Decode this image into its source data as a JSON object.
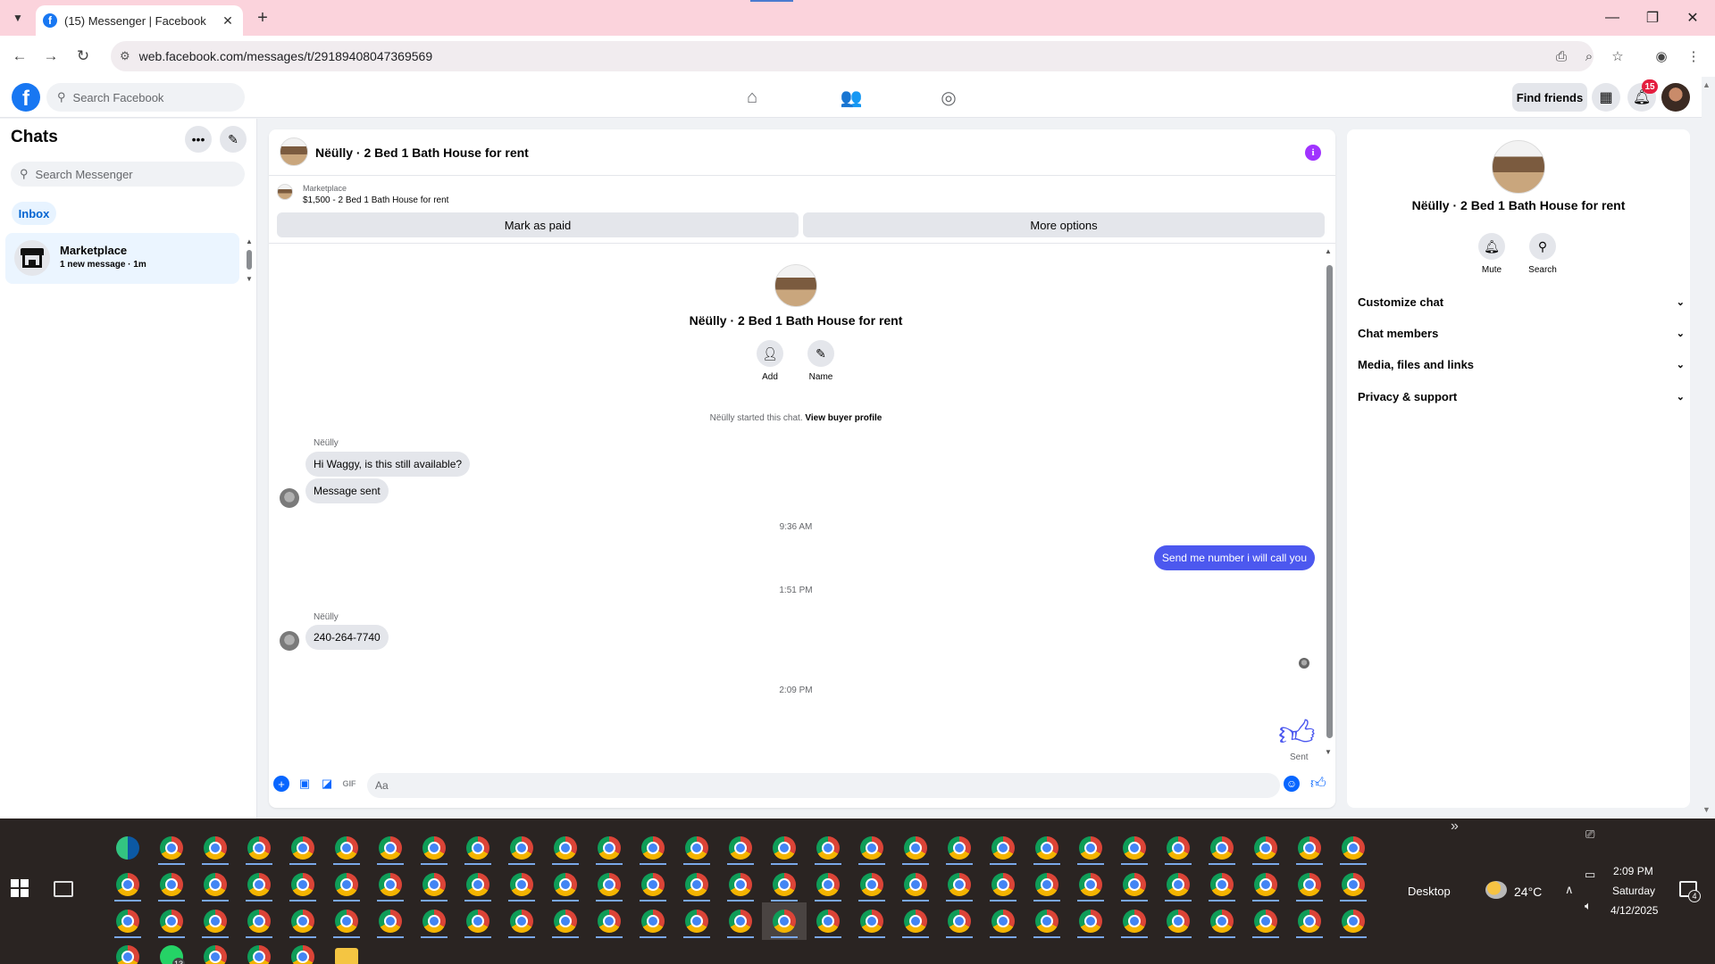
{
  "browser": {
    "tab_title": "(15) Messenger | Facebook",
    "url": "web.facebook.com/messages/t/29189408047369569",
    "new_tab_symbol": "+",
    "close_tab_symbol": "✕"
  },
  "fb": {
    "logo_letter": "f",
    "search_placeholder": "Search Facebook",
    "find_friends_label": "Find friends",
    "notification_count": "15"
  },
  "sidebar": {
    "title": "Chats",
    "search_placeholder": "Search Messenger",
    "inbox_label": "Inbox",
    "chats": [
      {
        "name": "Marketplace",
        "preview": "1 new message · 1m"
      }
    ]
  },
  "conversation": {
    "title": "Nëülly · 2 Bed 1 Bath House for rent",
    "marketplace_label": "Marketplace",
    "listing_line": "$1,500 - 2 Bed 1 Bath House for rent",
    "mark_paid_label": "Mark as paid",
    "more_options_label": "More options",
    "intro_name": "Nëülly · 2 Bed 1 Bath House for rent",
    "add_label": "Add",
    "name_label": "Name",
    "started_text": "Nëülly started this chat.",
    "view_profile_link": "View buyer profile",
    "messages": [
      {
        "sender": "Nëülly",
        "text": "Hi Waggy, is this still available?"
      },
      {
        "text": "Message sent"
      },
      {
        "timestamp": "9:36 AM"
      },
      {
        "mine": true,
        "text": "Send me number i will call you"
      },
      {
        "timestamp": "1:51 PM"
      },
      {
        "sender": "Nëülly",
        "text": "240-264-7740"
      },
      {
        "timestamp": "2:09 PM"
      }
    ],
    "sent_label": "Sent",
    "composer_placeholder": "Aa"
  },
  "info_panel": {
    "name": "Nëülly · 2 Bed 1 Bath House for rent",
    "mute_label": "Mute",
    "search_label": "Search",
    "sections": [
      "Customize chat",
      "Chat members",
      "Media, files and links",
      "Privacy & support"
    ]
  },
  "taskbar": {
    "desktop_label": "Desktop",
    "temperature": "24°C",
    "time": "2:09 PM",
    "day": "Saturday",
    "date": "4/12/2025",
    "whatsapp_badge": "13",
    "notification_badge": "4",
    "overflow_symbol": "»"
  },
  "colors": {
    "fb_blue": "#1877f2",
    "messenger_bubble": "#4c58ef",
    "tab_strip": "#fbd3dc",
    "taskbar": "#2a2422"
  }
}
